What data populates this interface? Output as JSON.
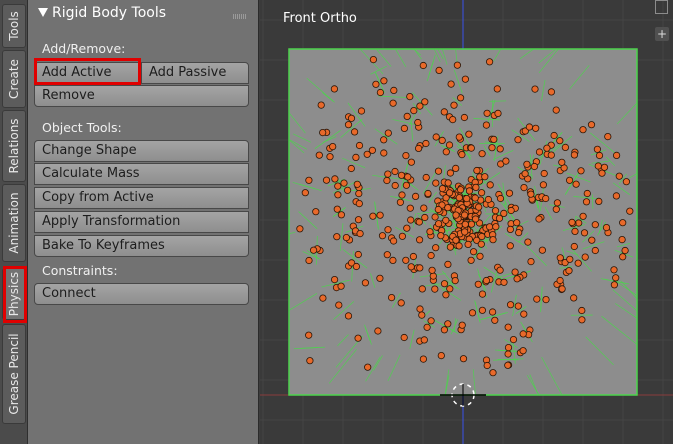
{
  "tabs": [
    {
      "label": "Tools",
      "active": false
    },
    {
      "label": "Create",
      "active": false
    },
    {
      "label": "Relations",
      "active": false
    },
    {
      "label": "Animation",
      "active": false
    },
    {
      "label": "Physics",
      "active": true
    },
    {
      "label": "Grease Pencil",
      "active": false
    }
  ],
  "panel": {
    "title": "Rigid Body Tools",
    "add_remove_label": "Add/Remove:",
    "add_active": "Add Active",
    "add_passive": "Add Passive",
    "remove": "Remove",
    "object_tools_label": "Object Tools:",
    "change_shape": "Change Shape",
    "calculate_mass": "Calculate Mass",
    "copy_from_active": "Copy from Active",
    "apply_transformation": "Apply Transformation",
    "bake_to_keyframes": "Bake To Keyframes",
    "constraints_label": "Constraints:",
    "connect": "Connect"
  },
  "viewport": {
    "title": "Front Ortho",
    "plus_label": "+"
  },
  "colors": {
    "highlight": "#e00000",
    "particle": "#e8692a",
    "voronoi": "#4cd44c",
    "plane": "#8d8d8d"
  }
}
